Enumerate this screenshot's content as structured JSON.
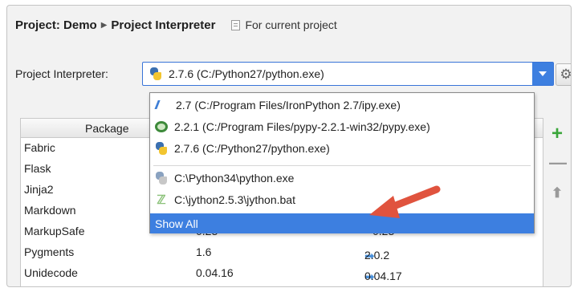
{
  "breadcrumb": {
    "project": "Project: Demo",
    "page": "Project Interpreter"
  },
  "scope_label": "For current project",
  "interpreter_label": "Project Interpreter:",
  "interpreter_selected": "2.7.6 (C:/Python27/python.exe)",
  "table": {
    "header_package": "Package",
    "rows": [
      {
        "name": "Fabric",
        "version": "",
        "latest": ""
      },
      {
        "name": "Flask",
        "version": "",
        "latest": ""
      },
      {
        "name": "Jinja2",
        "version": "",
        "latest": ""
      },
      {
        "name": "Markdown",
        "version": "",
        "latest": ""
      },
      {
        "name": "MarkupSafe",
        "version": "0.23",
        "latest": "0.23"
      },
      {
        "name": "Pygments",
        "version": "1.6",
        "latest": "2.0.2"
      },
      {
        "name": "Unidecode",
        "version": "0.04.16",
        "latest": "0.04.17"
      }
    ]
  },
  "dropdown_options": [
    {
      "label": "2.7 (C:/Program Files/IronPython 2.7/ipy.exe)",
      "icon": "ironpython-icon"
    },
    {
      "label": "2.2.1 (C:/Program Files/pypy-2.2.1-win32/pypy.exe)",
      "icon": "pypy-icon"
    },
    {
      "label": "2.7.6 (C:/Python27/python.exe)",
      "icon": "python-icon"
    },
    {
      "label": "C:\\Python34\\python.exe",
      "icon": "python-icon"
    },
    {
      "label": "C:\\jython2.5.3\\jython.bat",
      "icon": "jython-icon"
    }
  ],
  "show_all_label": "Show All",
  "colors": {
    "accent": "#3d7fe0",
    "annotation_arrow": "#e0533e",
    "add_green": "#3aa63a"
  }
}
